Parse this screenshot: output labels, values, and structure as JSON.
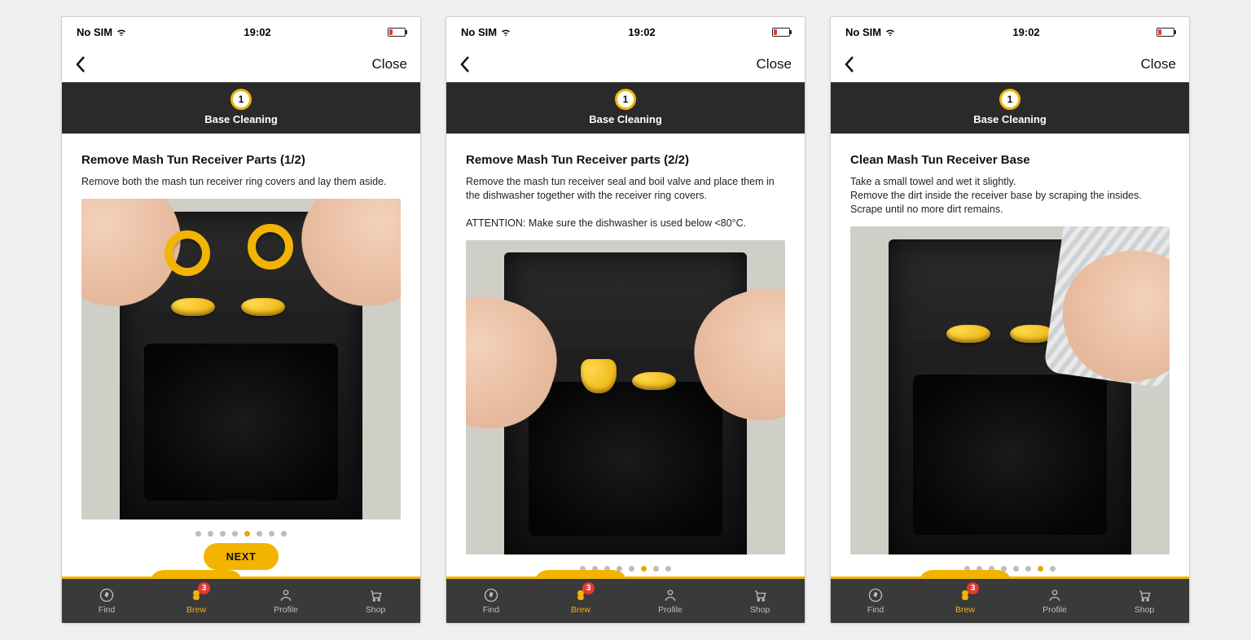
{
  "statusbar": {
    "carrier": "No SIM",
    "time": "19:02"
  },
  "nav": {
    "close": "Close"
  },
  "step": {
    "number": "1",
    "label": "Base Cleaning"
  },
  "screens": [
    {
      "title": "Remove Mash Tun Receiver Parts (1/2)",
      "body": "Remove both the mash tun receiver ring covers and lay them aside.",
      "pager": {
        "count": 8,
        "active": 4
      },
      "showNext": true,
      "imgVariant": "rings"
    },
    {
      "title": "Remove Mash Tun Receiver parts (2/2)",
      "body": "Remove the mash tun receiver seal and boil valve and place them in the dishwasher together with the receiver ring covers.\n\nATTENTION: Make sure the dishwasher is used below <80°C.",
      "pager": {
        "count": 8,
        "active": 5
      },
      "showNext": false,
      "imgVariant": "seals"
    },
    {
      "title": "Clean Mash Tun Receiver Base",
      "body": "Take a small towel and wet it slightly.\nRemove the dirt inside the receiver base by scraping the insides.\nScrape until no more dirt remains.",
      "pager": {
        "count": 8,
        "active": 6
      },
      "showNext": false,
      "imgVariant": "towel"
    }
  ],
  "next_label": "NEXT",
  "tabs": {
    "items": [
      {
        "label": "Find",
        "icon": "compass",
        "active": false
      },
      {
        "label": "Brew",
        "icon": "keg",
        "active": true,
        "badge": "3"
      },
      {
        "label": "Profile",
        "icon": "profile",
        "active": false
      },
      {
        "label": "Shop",
        "icon": "cart",
        "active": false
      }
    ]
  }
}
